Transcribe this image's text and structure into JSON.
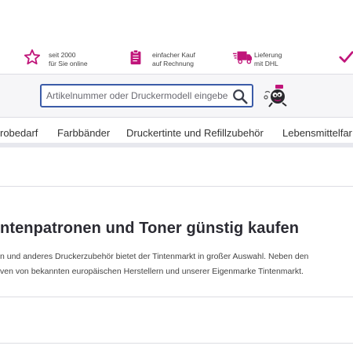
{
  "usps": [
    {
      "icon": "star-icon",
      "line1": "seit 2000",
      "line2": "für Sie online"
    },
    {
      "icon": "clipboard-icon",
      "line1": "einfacher Kauf",
      "line2": "auf Rechnung"
    },
    {
      "icon": "delivery-truck-icon",
      "line1": "Lieferung",
      "line2": "mit DHL"
    },
    {
      "icon": "checkmark-icon",
      "line1": "",
      "line2": ""
    }
  ],
  "search": {
    "placeholder": "Artikelnummer oder Druckermodell eingeben"
  },
  "nav": {
    "items": [
      "robedarf",
      "Farbbänder",
      "Druckertinte und Refillzubehör",
      "Lebensmittelfar"
    ]
  },
  "main": {
    "title": "ntenpatronen und  Toner günstig kaufen",
    "intro_line1": "n und anderes Druckerzubehör bietet der Tintenmarkt in großer Auswahl. Neben den",
    "intro_line2": "ven von bekannten europäischen Herstellern und unserer Eigenmarke Tintenmarkt."
  },
  "colors": {
    "accent": "#c0157a",
    "search_border": "#3b5ba8",
    "header_bg": "#f6f6f8"
  }
}
